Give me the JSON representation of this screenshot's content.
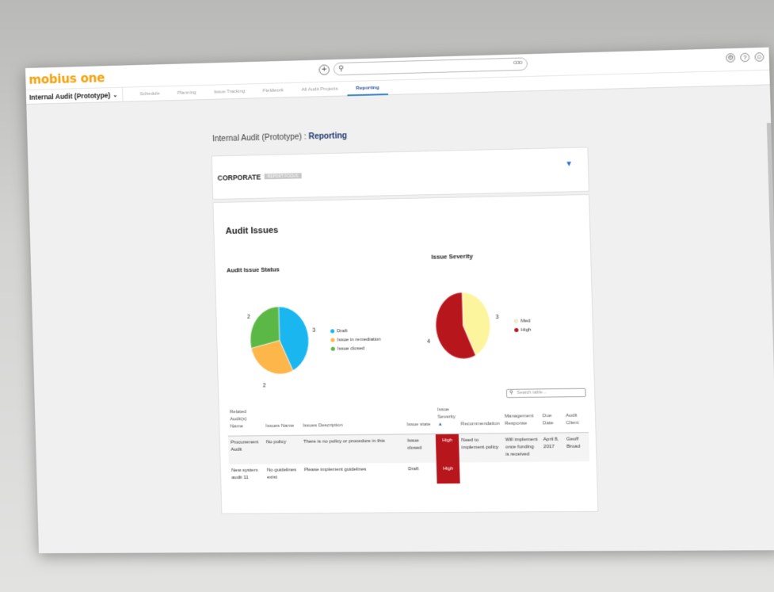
{
  "app": {
    "logo": "mobius one",
    "project": "Internal Audit (Prototype)",
    "tabs": [
      {
        "label": "Schedule",
        "active": false
      },
      {
        "label": "Planning",
        "active": false
      },
      {
        "label": "Issue Tracking",
        "active": false
      },
      {
        "label": "Fieldwork",
        "active": false
      },
      {
        "label": "All Audit Projects",
        "active": false
      },
      {
        "label": "Reporting",
        "active": true
      }
    ],
    "search_icon": "search-icon",
    "top_icons": [
      "settings-icon",
      "help-icon",
      "user-icon"
    ]
  },
  "breadcrumb": {
    "parent": "Internal Audit (Prototype)",
    "separator": " : ",
    "current": "Reporting"
  },
  "corporate": {
    "title": "CORPORATE",
    "tag": "REPORT FOCUS"
  },
  "issues": {
    "title": "Audit Issues",
    "table_search_placeholder": "Search table...",
    "columns": [
      "Related Audit(s) Name",
      "Issues Name",
      "Issues Description",
      "Issue state",
      "Issue Severity",
      "Recommendation",
      "Management Response",
      "Due Date",
      "Audit Client"
    ],
    "rows": [
      {
        "audit": "Procurement Audit",
        "name": "No policy",
        "description": "There is no policy or procedure in this",
        "state": "Issue closed",
        "severity": "High",
        "recommendation": "Need to implement policy",
        "response": "Will implement once funding is received",
        "due": "April 8, 2017",
        "client": "Geoff Broad"
      },
      {
        "audit": "New system audit 11",
        "name": "No guidelines exist",
        "description": "Please implement guidelines",
        "state": "Draft",
        "severity": "High",
        "recommendation": "",
        "response": "",
        "due": "",
        "client": ""
      }
    ]
  },
  "chart_data": [
    {
      "type": "pie",
      "title": "Audit Issue Status",
      "categories": [
        "Draft",
        "Issue in remediation",
        "Issue closed"
      ],
      "values": [
        3,
        2,
        2
      ],
      "colors": [
        "#1ab6ef",
        "#fcb64a",
        "#5cb846"
      ],
      "legend": "right"
    },
    {
      "type": "pie",
      "title": "Issue Severity",
      "categories": [
        "Med",
        "High"
      ],
      "values": [
        3,
        4
      ],
      "colors": [
        "#fdf59e",
        "#b8161d"
      ],
      "legend": "right"
    }
  ]
}
